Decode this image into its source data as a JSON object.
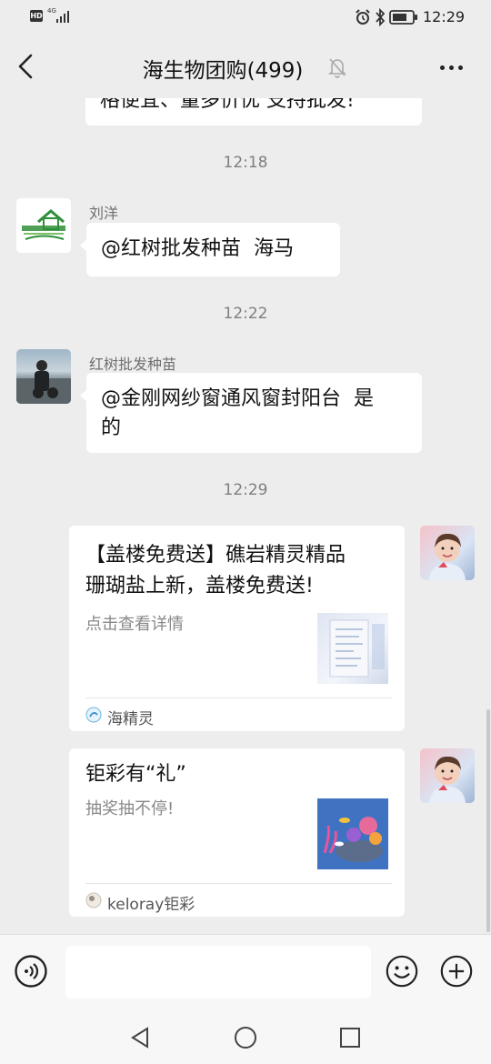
{
  "status_bar": {
    "badge": "HD",
    "network": "4G",
    "time": "12:29",
    "icons": [
      "alarm-icon",
      "bluetooth-icon",
      "battery-icon"
    ]
  },
  "header": {
    "title": "海生物团购(499)",
    "icons": [
      "back-icon",
      "mute-bell-icon",
      "more-icon"
    ]
  },
  "messages": {
    "partial_top": {
      "text": "格便宜、量多价优 支持批发!"
    },
    "time_1": "12:18",
    "msg_1": {
      "sender": "刘洋",
      "text": "@红树批发种苗  海马"
    },
    "time_2": "12:22",
    "msg_2": {
      "sender": "红树批发种苗",
      "line1": "@金刚网纱窗通风窗封阳台  是",
      "line2": "的"
    },
    "time_3": "12:29",
    "card_1": {
      "line1": "【盖楼免费送】礁岩精灵精品",
      "line2": "珊瑚盐上新，盖楼免费送!",
      "desc": "点击查看详情",
      "source": "海精灵"
    },
    "card_2": {
      "title": "钜彩有“礼”",
      "desc": "抽奖抽不停!",
      "source": "keloray钜彩"
    }
  },
  "input_bar": {
    "placeholder": "",
    "icons": [
      "voice-icon",
      "emoji-icon",
      "plus-icon"
    ]
  },
  "nav_bar": {
    "icons": [
      "nav-back-icon",
      "nav-home-icon",
      "nav-recents-icon"
    ]
  }
}
